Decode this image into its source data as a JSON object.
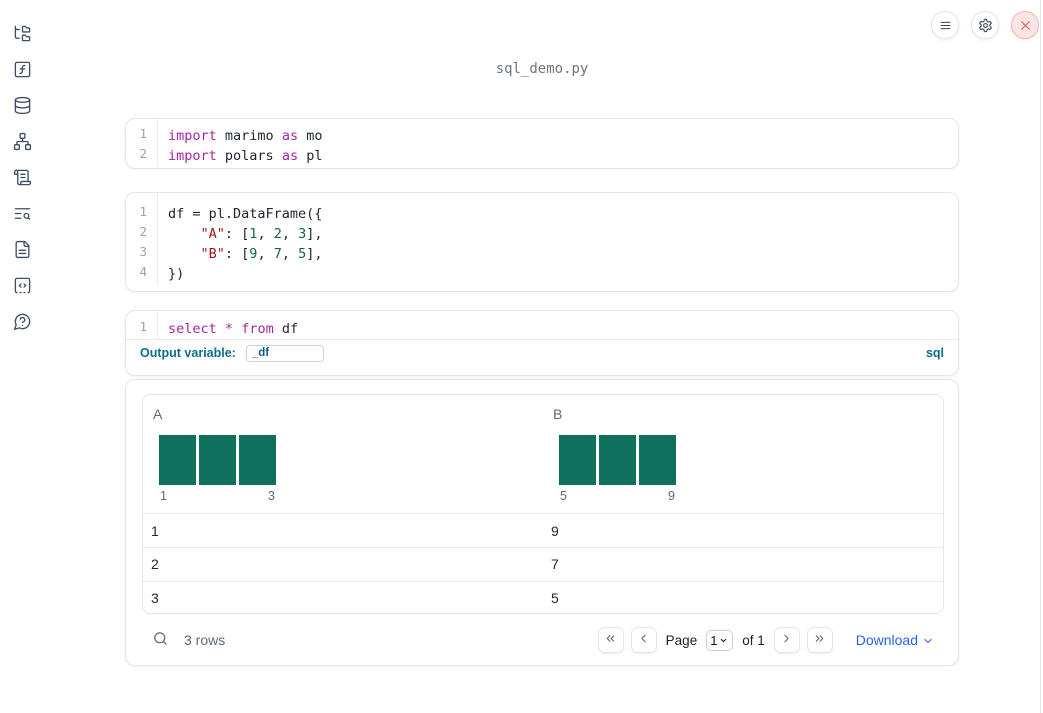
{
  "header": {
    "title": "sql_demo.py"
  },
  "window_controls": {
    "menu": {
      "name": "menu",
      "icon": "hamburger-icon"
    },
    "settings": {
      "name": "settings",
      "icon": "gear-icon"
    },
    "close": {
      "name": "close",
      "icon": "close-icon"
    }
  },
  "sidebar": {
    "items": [
      {
        "name": "file-explorer",
        "icon": "file-tree-icon"
      },
      {
        "name": "variables",
        "icon": "function-square-icon"
      },
      {
        "name": "data-sources",
        "icon": "database-icon"
      },
      {
        "name": "dependency-graph",
        "icon": "network-icon"
      },
      {
        "name": "logs",
        "icon": "scroll-icon"
      },
      {
        "name": "outline-search",
        "icon": "list-search-icon"
      },
      {
        "name": "documentation",
        "icon": "document-icon"
      },
      {
        "name": "snippets",
        "icon": "code-square-icon"
      },
      {
        "name": "help",
        "icon": "help-bubble-icon"
      }
    ]
  },
  "cells": [
    {
      "name": "imports-cell",
      "lines": [
        {
          "num": "1",
          "tokens": [
            [
              "kw",
              "import"
            ],
            [
              "plain",
              " marimo "
            ],
            [
              "kw",
              "as"
            ],
            [
              "plain",
              " mo"
            ]
          ]
        },
        {
          "num": "2",
          "tokens": [
            [
              "kw",
              "import"
            ],
            [
              "plain",
              " polars "
            ],
            [
              "kw",
              "as"
            ],
            [
              "plain",
              " pl"
            ]
          ]
        }
      ]
    },
    {
      "name": "dataframe-cell",
      "lines": [
        {
          "num": "1",
          "fold": true,
          "tokens": [
            [
              "plain",
              "df = pl.DataFrame({"
            ]
          ]
        },
        {
          "num": "2",
          "tokens": [
            [
              "plain",
              "    "
            ],
            [
              "str",
              "\"A\""
            ],
            [
              "plain",
              ": ["
            ],
            [
              "num",
              "1"
            ],
            [
              "plain",
              ", "
            ],
            [
              "num",
              "2"
            ],
            [
              "plain",
              ", "
            ],
            [
              "num",
              "3"
            ],
            [
              "plain",
              "],"
            ]
          ]
        },
        {
          "num": "3",
          "tokens": [
            [
              "plain",
              "    "
            ],
            [
              "str",
              "\"B\""
            ],
            [
              "plain",
              ": ["
            ],
            [
              "num",
              "9"
            ],
            [
              "plain",
              ", "
            ],
            [
              "num",
              "7"
            ],
            [
              "plain",
              ", "
            ],
            [
              "num",
              "5"
            ],
            [
              "plain",
              "],"
            ]
          ]
        },
        {
          "num": "4",
          "tokens": [
            [
              "plain",
              "})"
            ]
          ]
        }
      ]
    },
    {
      "name": "sql-cell",
      "lines": [
        {
          "num": "1",
          "tokens": [
            [
              "kw",
              "select"
            ],
            [
              "plain",
              " "
            ],
            [
              "kw",
              "*"
            ],
            [
              "plain",
              " "
            ],
            [
              "kw",
              "from"
            ],
            [
              "plain",
              " df"
            ]
          ]
        }
      ],
      "footer": {
        "label": "Output variable:",
        "value": "_df",
        "language": "sql"
      }
    }
  ],
  "table": {
    "columns": [
      {
        "label": "A",
        "histogram": {
          "bar_heights": [
            1,
            1,
            1
          ],
          "min_label": "1",
          "max_label": "3"
        }
      },
      {
        "label": "B",
        "histogram": {
          "bar_heights": [
            1,
            1,
            1
          ],
          "min_label": "5",
          "max_label": "9"
        }
      }
    ],
    "rows": [
      [
        "1",
        "9"
      ],
      [
        "2",
        "7"
      ],
      [
        "3",
        "5"
      ]
    ],
    "footer": {
      "row_count": "3 rows",
      "pagination": {
        "page_label": "Page",
        "page_value": "1",
        "of_label": "of 1"
      },
      "download_label": "Download"
    }
  },
  "colors": {
    "histogram_bar": "#0e6f5c",
    "sql_accent": "#0d6d8d",
    "link_blue": "#2563eb",
    "syntax_keyword": "#a626a4",
    "syntax_string": "#a31515",
    "syntax_number": "#116644",
    "close_button_red": "#d45c5c"
  }
}
